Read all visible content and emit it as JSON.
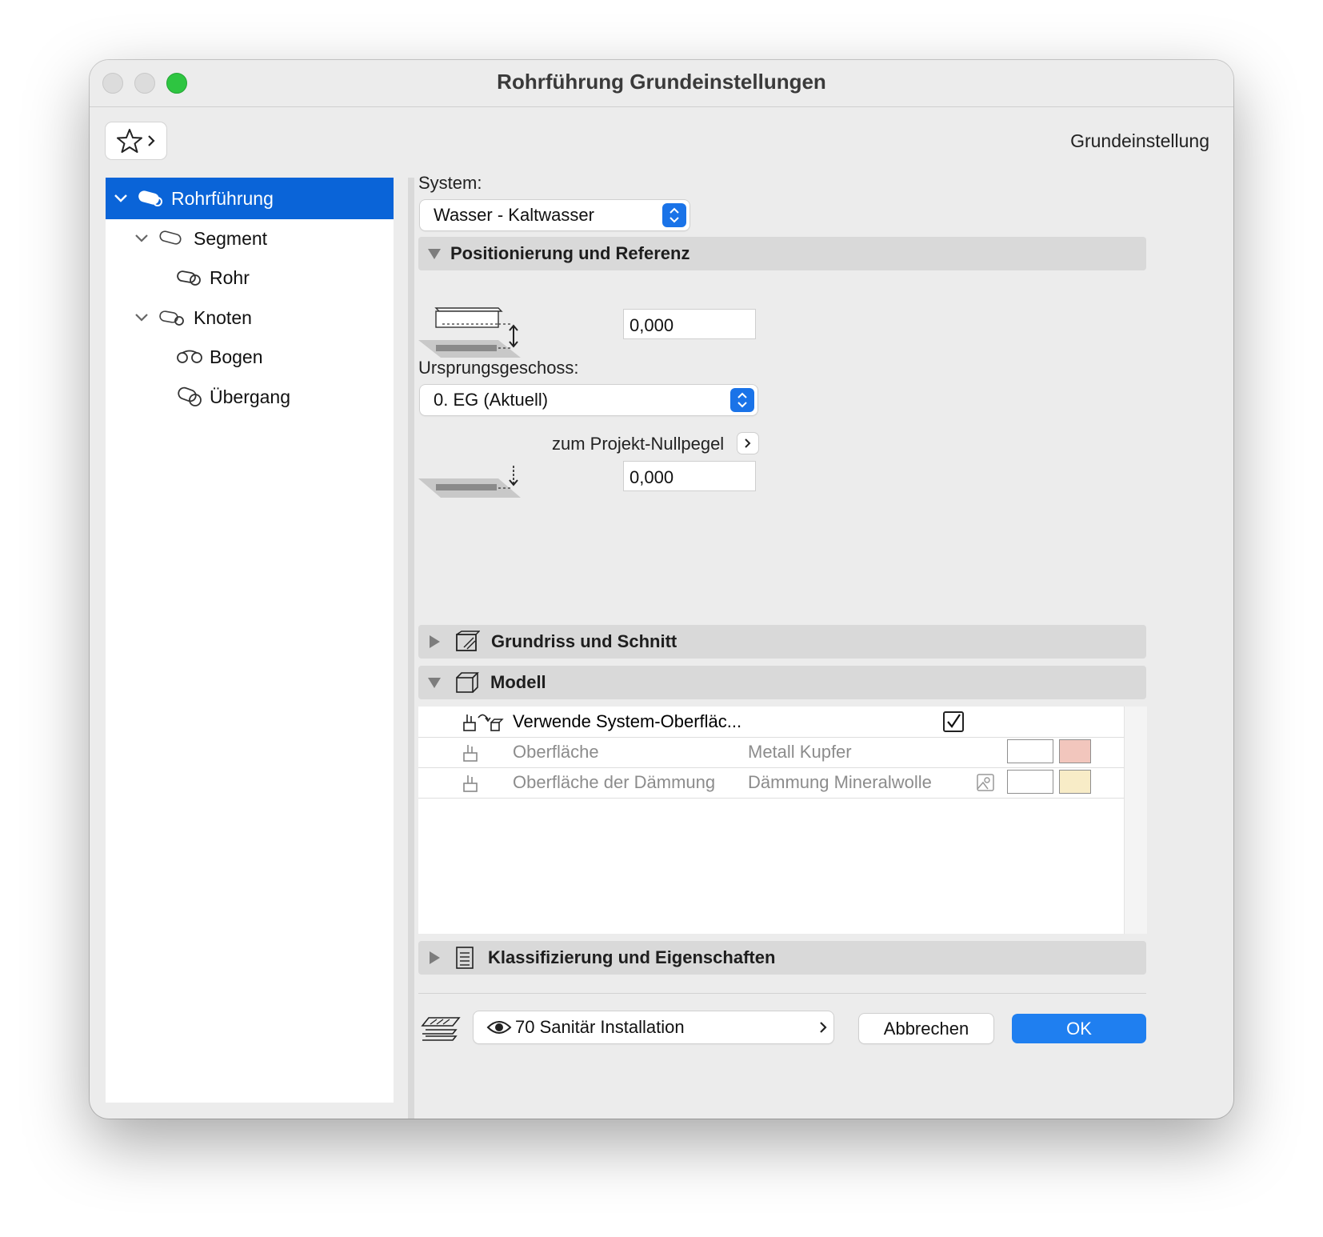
{
  "window": {
    "title": "Rohrführung Grundeinstellungen",
    "preset_label": "Grundeinstellung"
  },
  "tree": {
    "items": [
      {
        "label": "Rohrführung",
        "selected": true
      },
      {
        "label": "Segment"
      },
      {
        "label": "Rohr"
      },
      {
        "label": "Knoten"
      },
      {
        "label": "Bogen"
      },
      {
        "label": "Übergang"
      }
    ]
  },
  "system": {
    "label": "System:",
    "value": "Wasser - Kaltwasser"
  },
  "positioning": {
    "header": "Positionierung und Referenz",
    "offset_value": "0,000",
    "home_story_label": "Ursprungsgeschoss:",
    "home_story_value": "0. EG (Aktuell)",
    "reference_label": "zum Projekt-Nullpegel",
    "reference_value": "0,000"
  },
  "sections": {
    "floorplan": "Grundriss und Schnitt",
    "model": "Modell",
    "classification": "Klassifizierung und Eigenschaften"
  },
  "model_rows": [
    {
      "name": "Verwende System-Oberfläc...",
      "checked": true
    },
    {
      "name": "Oberfläche",
      "value": "Metall Kupfer",
      "swatch_color": "#f2c6bd"
    },
    {
      "name": "Oberfläche der Dämmung",
      "value": "Dämmung Mineralwolle",
      "swatch_color": "#f8ecc7"
    }
  ],
  "footer": {
    "layer": "70 Sanitär Installation",
    "cancel": "Abbrechen",
    "ok": "OK"
  },
  "colors": {
    "selection": "#0a64d8",
    "ok_button": "#1f7ff0",
    "traffic_green": "#2ec541"
  }
}
